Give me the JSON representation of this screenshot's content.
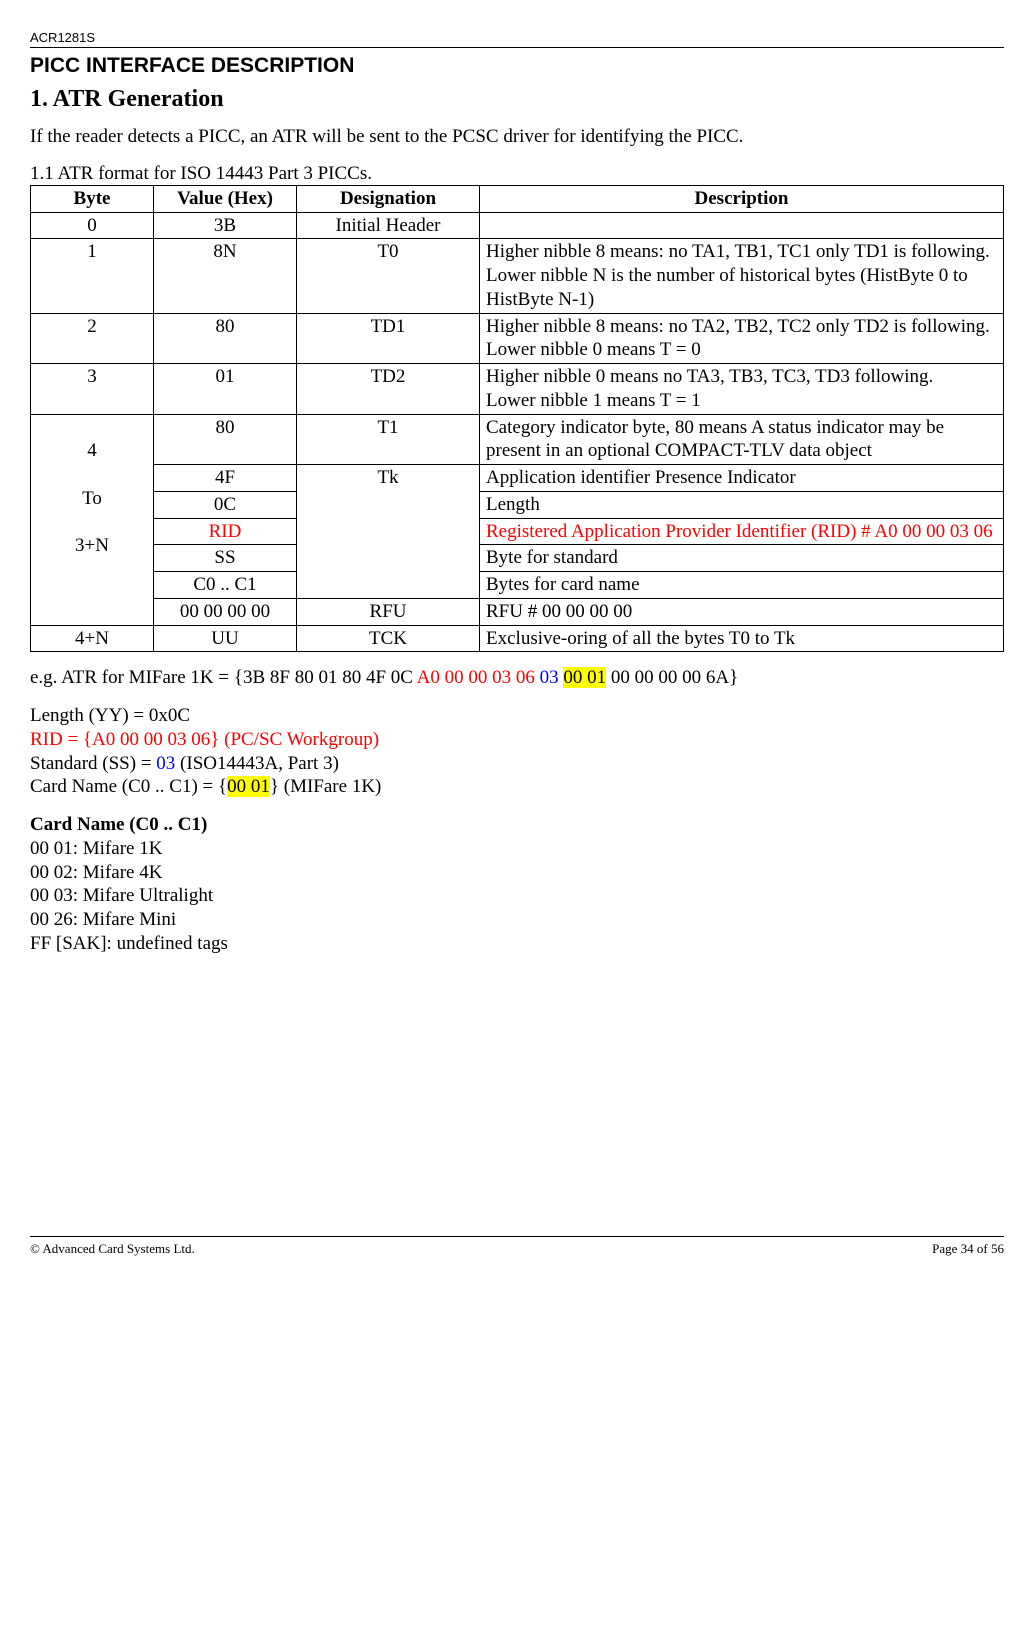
{
  "doc": {
    "header": "ACR1281S"
  },
  "h": {
    "picc": "PICC INTERFACE DESCRIPTION",
    "section": "1. ATR Generation"
  },
  "intro": "If the reader detects a PICC, an ATR will be sent to the PCSC driver for identifying the PICC.",
  "table": {
    "caption": "1.1 ATR format for ISO 14443 Part 3 PICCs.",
    "headers": {
      "byte": "Byte",
      "value": "Value (Hex)",
      "designation": "Designation",
      "description": "Description"
    },
    "rows": {
      "r0": {
        "byte": "0",
        "value": "3B",
        "designation": "Initial Header",
        "description": ""
      },
      "r1": {
        "byte": "1",
        "value": "8N",
        "designation": "T0",
        "description": "Higher nibble 8 means: no TA1, TB1, TC1 only TD1 is following.\nLower nibble N is the number of historical bytes (HistByte 0 to HistByte N-1)"
      },
      "r2": {
        "byte": "2",
        "value": "80",
        "designation": "TD1",
        "description": "Higher nibble 8 means: no TA2, TB2, TC2 only TD2 is following.\nLower nibble 0 means T = 0"
      },
      "r3": {
        "byte": "3",
        "value": "01",
        "designation": "TD2",
        "description": "Higher nibble 0 means no TA3, TB3, TC3, TD3 following.\nLower nibble 1 means T = 1"
      },
      "group": {
        "byte_1": "4",
        "byte_2": "To",
        "byte_3": "3+N",
        "t1": {
          "value": "80",
          "designation": "T1",
          "description": "Category indicator byte, 80 means A status indicator may be present in an optional COMPACT-TLV data object"
        },
        "tk": {
          "designation": "Tk"
        },
        "rA": {
          "value": "4F",
          "description": "Application identifier Presence Indicator"
        },
        "rB": {
          "value": "0C",
          "description": "Length"
        },
        "rC": {
          "value": "RID",
          "description": "Registered Application Provider Identifier (RID) # A0 00 00 03 06"
        },
        "rD": {
          "value": "SS",
          "description": "Byte for standard"
        },
        "rE": {
          "value": "C0 .. C1",
          "description": "Bytes for card name"
        },
        "rfu": {
          "value": "00 00 00 00",
          "designation": "RFU",
          "description": "RFU # 00 00 00 00"
        }
      },
      "tck": {
        "byte": "4+N",
        "value": "UU",
        "designation": "TCK",
        "description": "Exclusive-oring of all the bytes T0 to Tk"
      }
    }
  },
  "example": {
    "prefix": "e.g. ATR for MIFare 1K  = {3B 8F 80 01 80 4F 0C ",
    "red": "A0 00 00 03 06 ",
    "blue": "03 ",
    "hl": "00 01",
    "suffix": " 00 00 00 00 6A}"
  },
  "defs": {
    "length": "Length (YY) = 0x0C",
    "rid": "RID = {A0 00 00 03 06} (PC/SC Workgroup)",
    "std_pre": "Standard (SS) = ",
    "std_blue": "03",
    "std_post": " (ISO14443A, Part 3)",
    "card_pre": "Card Name (C0 .. C1) = {",
    "card_hl": "00 01",
    "card_post": "} (MIFare 1K)"
  },
  "cardnames": {
    "title": "Card Name (C0 .. C1)",
    "items": [
      "00 01: Mifare 1K",
      "00 02: Mifare 4K",
      "00 03: Mifare Ultralight",
      "00 26: Mifare Mini",
      "FF [SAK]: undefined tags"
    ]
  },
  "footer": {
    "left": "© Advanced Card Systems Ltd.",
    "right": "Page 34 of 56"
  }
}
